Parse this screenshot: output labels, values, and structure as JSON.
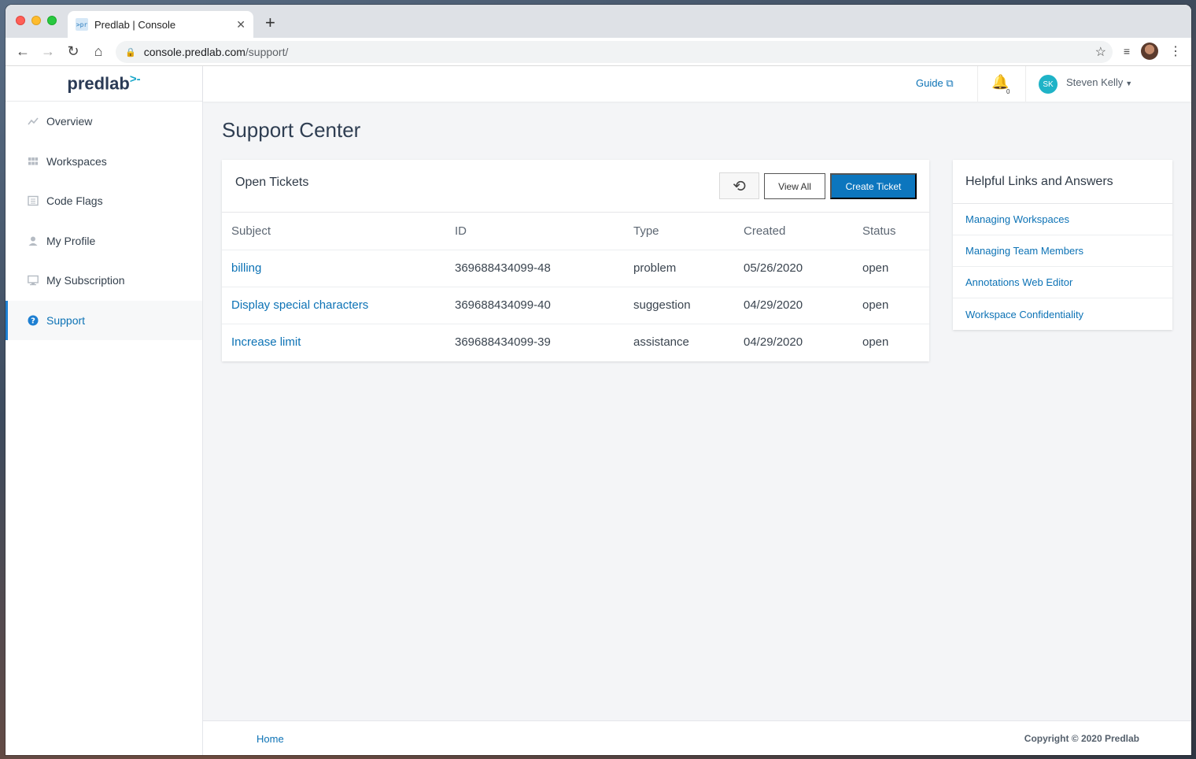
{
  "browser": {
    "tab_title": "Predlab | Console",
    "tab_favicon_text": ">pr",
    "url_host": "console.predlab.com",
    "url_path": "/support/"
  },
  "app": {
    "logo": "predlab",
    "logo_mark": ">-"
  },
  "sidebar": {
    "items": [
      {
        "label": "Overview",
        "icon": "chart-line-icon"
      },
      {
        "label": "Workspaces",
        "icon": "grid-icon"
      },
      {
        "label": "Code Flags",
        "icon": "calendar-icon"
      },
      {
        "label": "My Profile",
        "icon": "user-icon"
      },
      {
        "label": "My Subscription",
        "icon": "monitor-icon"
      },
      {
        "label": "Support",
        "icon": "question-circle-icon",
        "active": true
      }
    ]
  },
  "topbar": {
    "guide_label": "Guide",
    "notification_count": "0",
    "avatar_initials": "SK",
    "user_name": "Steven Kelly"
  },
  "page": {
    "title": "Support Center"
  },
  "tickets": {
    "title": "Open Tickets",
    "view_all_label": "View All",
    "create_label": "Create Ticket",
    "columns": [
      "Subject",
      "ID",
      "Type",
      "Created",
      "Status"
    ],
    "rows": [
      {
        "subject": "billing",
        "id": "369688434099-48",
        "type": "problem",
        "created": "05/26/2020",
        "status": "open"
      },
      {
        "subject": "Display special characters",
        "id": "369688434099-40",
        "type": "suggestion",
        "created": "04/29/2020",
        "status": "open"
      },
      {
        "subject": "Increase limit",
        "id": "369688434099-39",
        "type": "assistance",
        "created": "04/29/2020",
        "status": "open"
      }
    ]
  },
  "helpful_links": {
    "title": "Helpful Links and Answers",
    "items": [
      "Managing Workspaces",
      "Managing Team Members",
      "Annotations Web Editor",
      "Workspace Confidentiality"
    ]
  },
  "footer": {
    "home_label": "Home",
    "copyright": "Copyright © 2020 Predlab"
  },
  "colors": {
    "accent": "#0c72b5",
    "primary_button": "#0c76be",
    "avatar": "#1fb3c7"
  }
}
